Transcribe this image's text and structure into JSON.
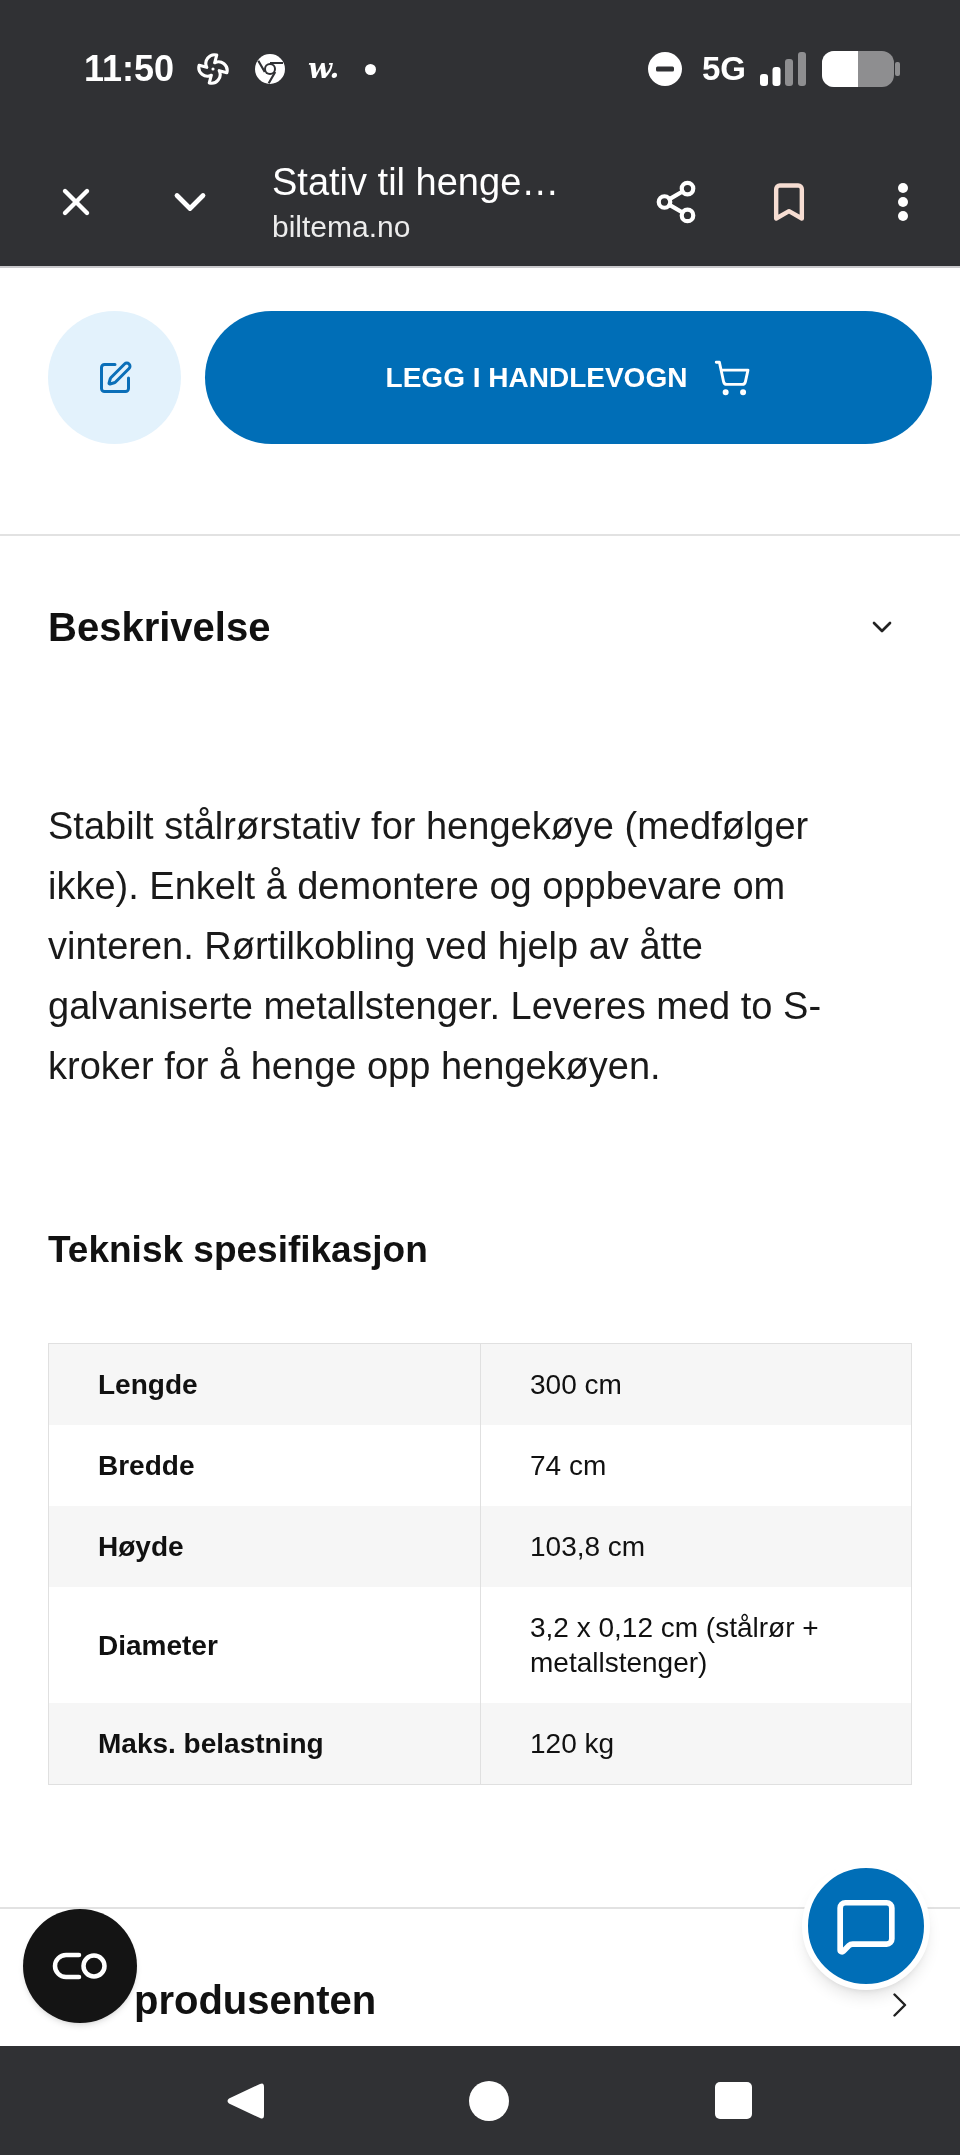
{
  "status_bar": {
    "time": "11:50",
    "app_badge": "w.",
    "network": "5G"
  },
  "browser_toolbar": {
    "title": "Stativ til henge…",
    "url": "biltema.no"
  },
  "actions": {
    "add_to_cart": "LEGG I HANDLEVOGN"
  },
  "sections": [
    {
      "heading": "Beskrivelse",
      "expanded": true,
      "description": "Stabilt stålrørstativ for hengekøye (medfølger ikke). Enkelt å demontere og oppbevare om vinteren. Rørtilkobling ved hjelp av åtte galvaniserte metallstenger. Leveres med to S-kroker for å henge opp hengekøyen.",
      "spec_heading": "Teknisk spesifikasjon",
      "specs": [
        {
          "label": "Lengde",
          "value": "300 cm"
        },
        {
          "label": "Bredde",
          "value": "74 cm"
        },
        {
          "label": "Høyde",
          "value": "103,8 cm"
        },
        {
          "label": "Diameter",
          "value": "3,2 x 0,12 cm (stålrør + metallstenger)"
        },
        {
          "label": "Maks. belastning",
          "value": "120 kg"
        }
      ]
    },
    {
      "heading": "produsenten",
      "expanded": false
    }
  ]
}
